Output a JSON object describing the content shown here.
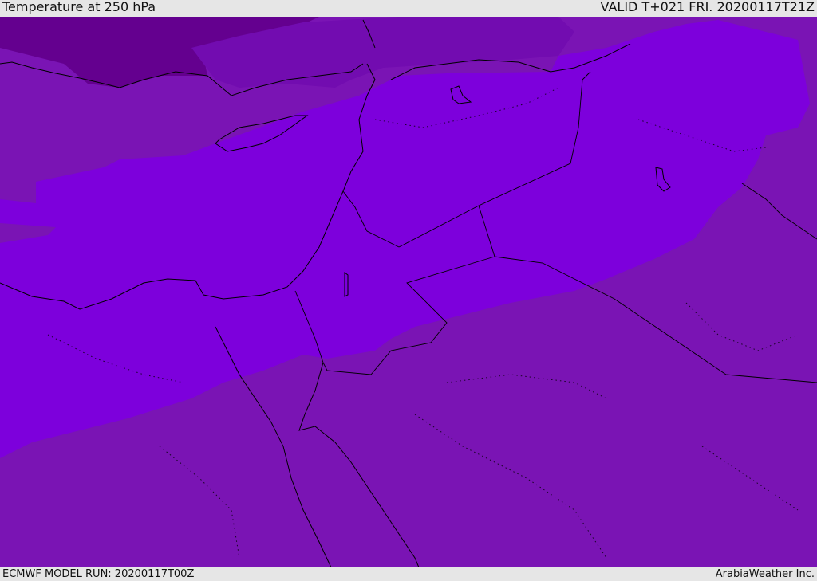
{
  "header": {
    "title": "Temperature at 250 hPa",
    "valid": "VALID T+021 FRI. 20200117T21Z"
  },
  "footer": {
    "model_run": "ECMWF MODEL RUN: 20200117T00Z",
    "credit": "ArabiaWeather Inc."
  },
  "colors": {
    "warm_band": "#7a14b4",
    "cold_band": "#7d00dc",
    "coldest_band": "#64008f",
    "mid_band": "#6e0aa8",
    "coastline": "#000000"
  }
}
